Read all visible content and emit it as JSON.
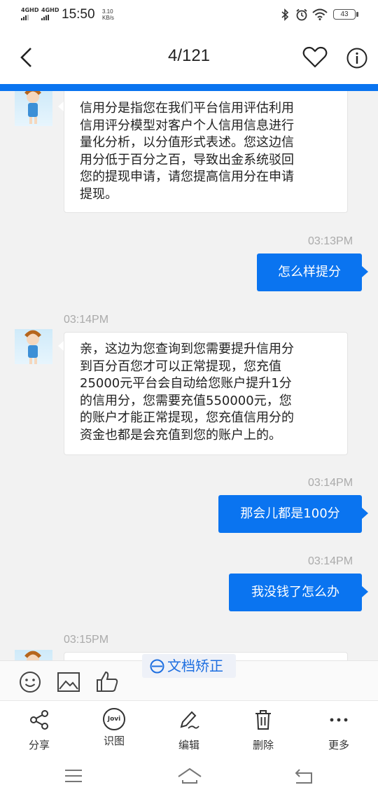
{
  "status_bar": {
    "signal1": "4GHD",
    "signal2": "4GHD",
    "time": "15:50",
    "speed_value": "3.10",
    "speed_unit": "KB/s",
    "battery": "43"
  },
  "header": {
    "page_counter": "4/121"
  },
  "chat": {
    "msg1": [
      "信用分是指您在我们平台信用评估利用",
      "信用评分模型对客户个人信用信息进行",
      "量化分析，以分值形式表述。您这边信",
      "用分低于百分之百，导致出金系统驳回",
      "您的提现申请，请您提高信用分在申请",
      "提现。"
    ],
    "time2": "03:13PM",
    "msg2": "怎么样提分",
    "time3": "03:14PM",
    "msg3": [
      "亲，这边为您查询到您需要提升信用分",
      "到百分百您才可以正常提现，您充值",
      "25000元平台会自动给您账户提升1分",
      "的信用分，您需要充值550000元，您",
      "的账户才能正常提现，您充值信用分的",
      "资金也都是会充值到您的账户上的。"
    ],
    "time4": "03:14PM",
    "msg4": "那会儿都是100分",
    "time5": "03:14PM",
    "msg5": "我没钱了怎么办",
    "time6": "03:15PM"
  },
  "toolbar": {
    "doc_correct": "文档矫正"
  },
  "actions": {
    "share": "分享",
    "recognize": "识图",
    "jovi": "Jovi",
    "edit": "编辑",
    "delete": "删除",
    "more": "更多"
  },
  "colors": {
    "accent": "#0a74f0"
  }
}
